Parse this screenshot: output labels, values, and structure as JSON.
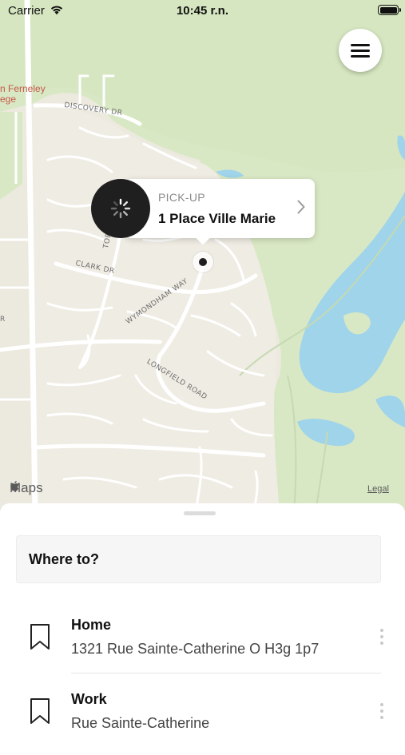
{
  "status_bar": {
    "carrier": "Carrier",
    "time": "10:45 r.n."
  },
  "map": {
    "poi_label_line1": "n Ferneley",
    "poi_label_line2": "ege",
    "streets": {
      "discovery": "DISCOVERY DR",
      "torrance": "TORRANCE",
      "clark": "CLARK DR",
      "wymondham": "WYMONDHAM WAY",
      "longfield": "LONGFIELD ROAD",
      "edge_r": "R"
    },
    "maps_logo": "Maps",
    "legal": "Legal",
    "colors": {
      "land": "#ece9df",
      "park": "#d9e8c4",
      "water": "#9fd4ea",
      "road": "#ffffff"
    }
  },
  "pickup": {
    "label": "PICK-UP",
    "address": "1 Place Ville Marie"
  },
  "sheet": {
    "search_placeholder": "Where to?",
    "places": [
      {
        "title": "Home",
        "subtitle": "1321 Rue Sainte-Catherine O H3g 1p7",
        "icon": "bookmark-icon"
      },
      {
        "title": "Work",
        "subtitle": "Rue Sainte-Catherine",
        "icon": "bookmark-icon"
      }
    ]
  }
}
